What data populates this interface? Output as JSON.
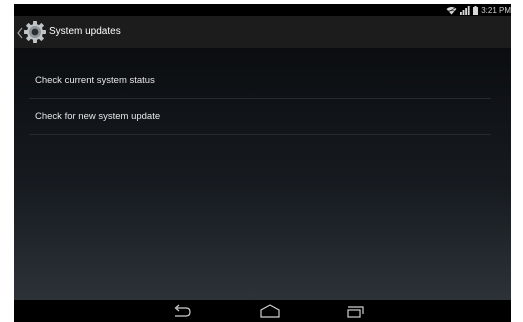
{
  "status_bar": {
    "time": "3:21 PM"
  },
  "action_bar": {
    "title": "System updates",
    "icon": "settings-gear-icon",
    "background": "#1c1c1c"
  },
  "preferences": [
    {
      "label": "Check current system status"
    },
    {
      "label": "Check for new system update"
    }
  ],
  "navigation": {
    "buttons": [
      "back-icon",
      "home-icon",
      "recent-apps-icon"
    ]
  }
}
